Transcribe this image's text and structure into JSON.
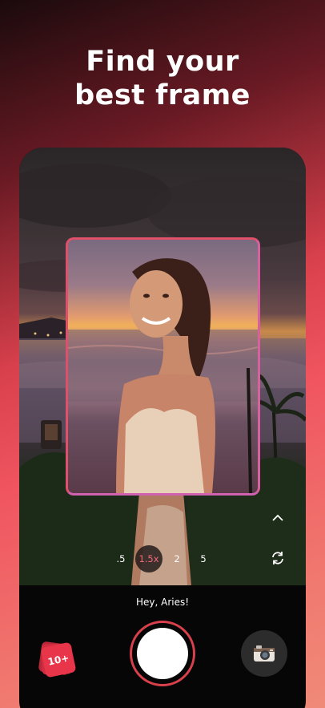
{
  "headline": {
    "line1": "Find your",
    "line2": "best frame"
  },
  "camera": {
    "zoom_options": [
      ".5",
      "1.5x",
      "2",
      "5"
    ],
    "selected_zoom": "1.5x",
    "collapse_icon": "chevron-up-icon",
    "flip_icon": "flip-camera-icon",
    "greeting": "Hey, Aries!",
    "gallery_badge": "10+",
    "shutter_icon": "shutter-icon",
    "mode_icon": "retro-camera-icon"
  },
  "colors": {
    "accent": "#e8354a",
    "frame_border": "#e0506a",
    "background_gradient_end": "#f08a78"
  }
}
